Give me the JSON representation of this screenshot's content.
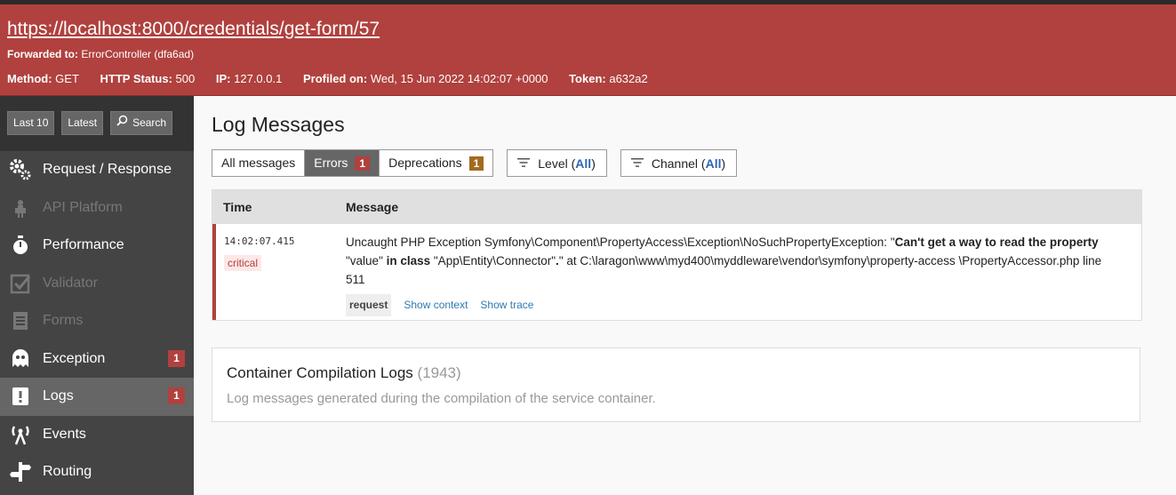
{
  "header": {
    "url": "https://localhost:8000/credentials/get-form/57",
    "forwarded_label": "Forwarded to:",
    "forwarded_value": "ErrorController (dfa6ad)",
    "meta": [
      {
        "label": "Method:",
        "value": "GET"
      },
      {
        "label": "HTTP Status:",
        "value": "500"
      },
      {
        "label": "IP:",
        "value": "127.0.0.1"
      },
      {
        "label": "Profiled on:",
        "value": "Wed, 15 Jun 2022 14:02:07 +0000"
      },
      {
        "label": "Token:",
        "value": "a632a2"
      }
    ]
  },
  "sidebar": {
    "buttons": [
      {
        "label": "Last 10"
      },
      {
        "label": "Latest"
      },
      {
        "label": "Search"
      }
    ],
    "items": [
      {
        "label": "Request / Response",
        "icon": "gears-icon"
      },
      {
        "label": "API Platform",
        "icon": "spider-icon"
      },
      {
        "label": "Performance",
        "icon": "stopwatch-icon"
      },
      {
        "label": "Validator",
        "icon": "checkbox-icon"
      },
      {
        "label": "Forms",
        "icon": "form-icon"
      },
      {
        "label": "Exception",
        "icon": "ghost-icon",
        "count": "1"
      },
      {
        "label": "Logs",
        "icon": "logbook-icon",
        "count": "1"
      },
      {
        "label": "Events",
        "icon": "broadcast-icon"
      },
      {
        "label": "Routing",
        "icon": "signpost-icon"
      }
    ]
  },
  "main": {
    "title": "Log Messages",
    "tabs": [
      {
        "label": "All messages"
      },
      {
        "label": "Errors",
        "count": "1"
      },
      {
        "label": "Deprecations",
        "count": "1"
      }
    ],
    "level_filter": {
      "label": "Level",
      "value": "All"
    },
    "channel_filter": {
      "label": "Channel",
      "value": "All"
    },
    "table": {
      "headers": [
        "Time",
        "Message"
      ],
      "rows": [
        {
          "time": "14:02:07.415",
          "level": "critical",
          "msg_1": "Uncaught PHP Exception Symfony\\Component\\PropertyAccess\\Exception\\NoSuchPropertyException: \"",
          "msg_2": "Can't get a way to read the property",
          "msg_3": " \"value\" ",
          "msg_4": "in class",
          "msg_5": " \"App\\Entity\\Connector\"",
          "msg_6": ".",
          "msg_7": "\" at C:\\laragon\\www\\myd400\\myddleware\\vendor\\symfony\\property-access \\PropertyAccessor.php line 511",
          "channel": "request",
          "show_context": "Show context",
          "show_trace": "Show trace"
        }
      ]
    },
    "compilation": {
      "title": "Container Compilation Logs",
      "count": "(1943)",
      "description": "Log messages generated during the compilation of the service container."
    }
  }
}
